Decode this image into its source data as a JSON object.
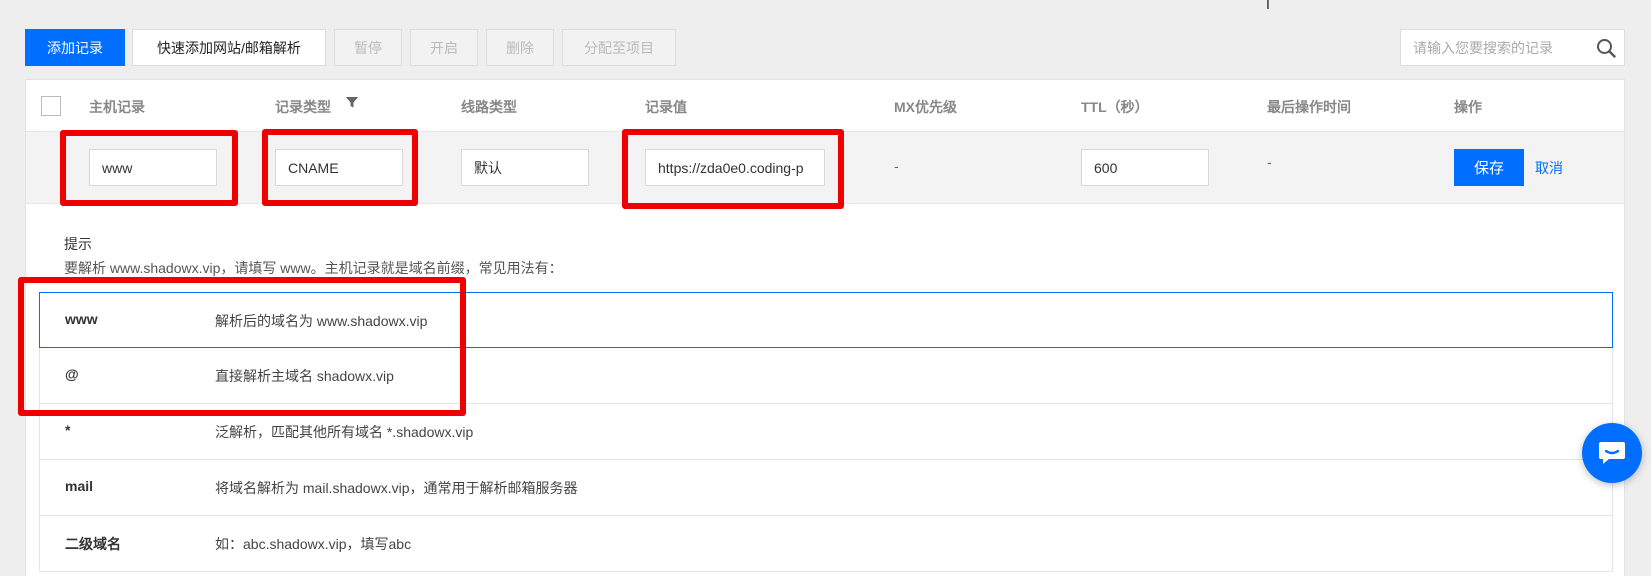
{
  "toolbar": {
    "add_record": "添加记录",
    "quick_add": "快速添加网站/邮箱解析",
    "pause": "暂停",
    "enable": "开启",
    "delete": "删除",
    "assign_project": "分配至项目"
  },
  "search": {
    "placeholder": "请输入您要搜索的记录"
  },
  "table": {
    "headers": {
      "host": "主机记录",
      "type": "记录类型",
      "line": "线路类型",
      "value": "记录值",
      "mx": "MX优先级",
      "ttl": "TTL（秒）",
      "last_op": "最后操作时间",
      "action": "操作"
    },
    "edit_row": {
      "host": "www",
      "type": "CNAME",
      "line": "默认",
      "value": "https://zda0e0.coding-p",
      "mx": "-",
      "ttl": "600",
      "last_op": "-",
      "save": "保存",
      "cancel": "取消"
    }
  },
  "hint": {
    "title": "提示",
    "text": "要解析 www.shadowx.vip，请填写 www。主机记录就是域名前缀，常见用法有：",
    "items": [
      {
        "key": "www",
        "desc": "解析后的域名为 www.shadowx.vip"
      },
      {
        "key": "@",
        "desc": "直接解析主域名 shadowx.vip"
      },
      {
        "key": "*",
        "desc": "泛解析，匹配其他所有域名 *.shadowx.vip"
      },
      {
        "key": "mail",
        "desc": "将域名解析为 mail.shadowx.vip，通常用于解析邮箱服务器"
      },
      {
        "key": "二级域名",
        "desc": "如：abc.shadowx.vip，填写abc"
      }
    ]
  },
  "colors": {
    "primary": "#006eff",
    "annotation": "#ee0000"
  },
  "icons": {
    "search": "search-icon",
    "filter": "filter-icon",
    "chat": "chat-icon"
  }
}
